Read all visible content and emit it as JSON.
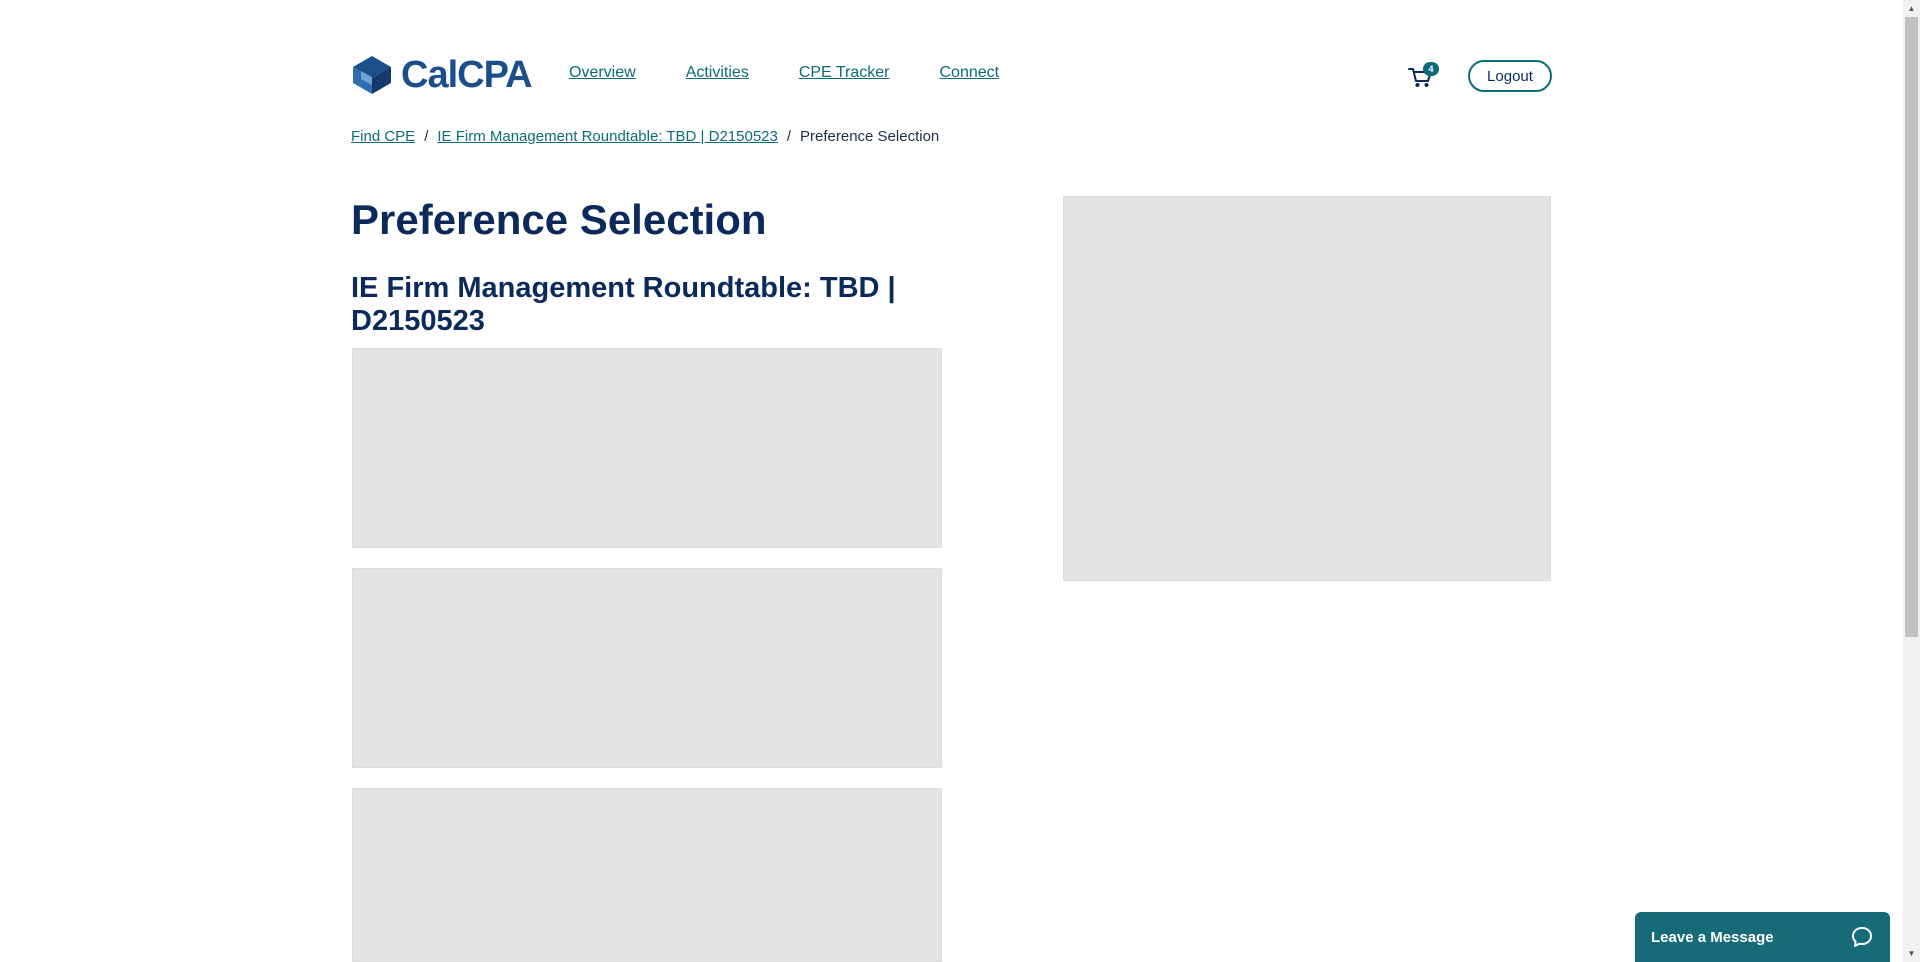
{
  "brand": {
    "name": "CalCPA",
    "accent": "#0d6b78",
    "navy": "#0b2a5b"
  },
  "nav": {
    "items": [
      {
        "label": "Overview"
      },
      {
        "label": "Activities"
      },
      {
        "label": "CPE Tracker"
      },
      {
        "label": "Connect"
      }
    ]
  },
  "header": {
    "cart_icon": "shopping-cart-icon",
    "cart_count": "4",
    "logout_label": "Logout"
  },
  "breadcrumb": {
    "items": [
      {
        "label": "Find CPE"
      },
      {
        "label": "IE Firm Management Roundtable: TBD | D2150523"
      }
    ],
    "separator": "/",
    "current": "Preference Selection"
  },
  "main": {
    "title": "Preference Selection",
    "event_title": "IE Firm Management Roundtable: TBD | D2150523"
  },
  "chat": {
    "label": "Leave a Message",
    "icon": "chat-bubble-icon"
  }
}
